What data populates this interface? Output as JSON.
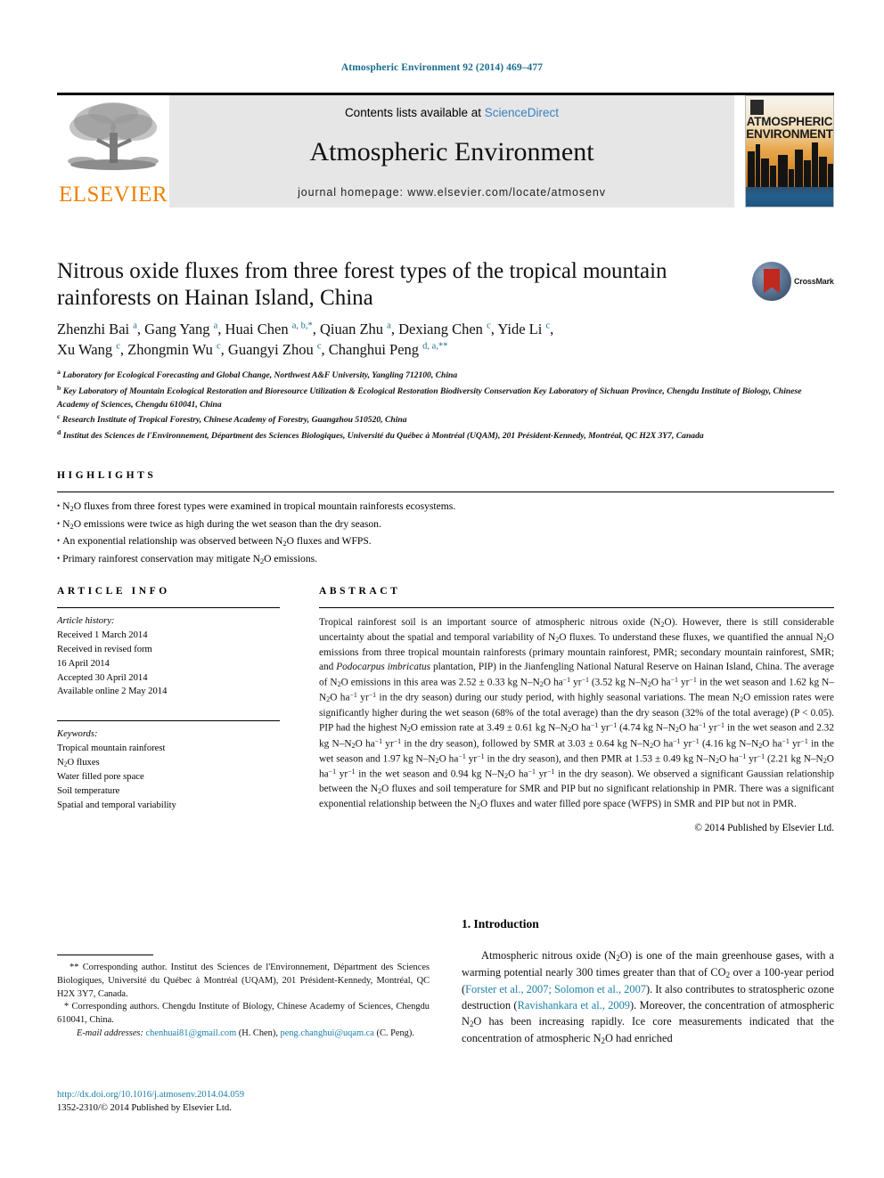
{
  "running_head": "Atmospheric Environment 92 (2014) 469–477",
  "masthead": {
    "elsevier_wordmark": "ELSEVIER",
    "contents_prefix": "Contents lists available at ",
    "sciencedirect": "ScienceDirect",
    "journal_title": "Atmospheric Environment",
    "homepage": "journal homepage: www.elsevier.com/locate/atmosenv",
    "cover_title_line1": "ATMOSPHERIC",
    "cover_title_line2": "ENVIRONMENT"
  },
  "article": {
    "title": "Nitrous oxide fluxes from three forest types of the tropical mountain rainforests on Hainan Island, China",
    "crossmark_label": "CrossMark",
    "authors_line1": "Zhenzhi Bai <sup>a</sup>, Gang Yang <sup>a</sup>, Huai Chen <sup>a, b,</sup><sup>*</sup>, Qiuan Zhu <sup>a</sup>, Dexiang Chen <sup>c</sup>, Yide Li <sup>c</sup>,",
    "authors_line2": "Xu Wang <sup>c</sup>, Zhongmin Wu <sup>c</sup>, Guangyi Zhou <sup>c</sup>, Changhui Peng <sup>d, a,</sup><sup>**</sup>",
    "affiliations": [
      "<sup>a</sup> Laboratory for Ecological Forecasting and Global Change, Northwest A&F University, Yangling 712100, China",
      "<sup>b</sup> Key Laboratory of Mountain Ecological Restoration and Bioresource Utilization &amp; Ecological Restoration Biodiversity Conservation Key Laboratory of Sichuan Province, Chengdu Institute of Biology, Chinese Academy of Sciences, Chengdu 610041, China",
      "<sup>c</sup> Research Institute of Tropical Forestry, Chinese Academy of Forestry, Guangzhou 510520, China",
      "<sup>d</sup> Institut des Sciences de l'Environnement, Départment des Sciences Biologiques, Université du Québec à Montréal (UQAM), 201 Président-Kennedy, Montréal, QC H2X 3Y7, Canada"
    ]
  },
  "highlights": {
    "label": "HIGHLIGHTS",
    "items": [
      "N<sub>2</sub>O fluxes from three forest types were examined in tropical mountain rainforests ecosystems.",
      "N<sub>2</sub>O emissions were twice as high during the wet season than the dry season.",
      "An exponential relationship was observed between N<sub>2</sub>O fluxes and WFPS.",
      "Primary rainforest conservation may mitigate N<sub>2</sub>O emissions."
    ]
  },
  "article_info": {
    "label": "ARTICLE INFO",
    "history_label": "Article history:",
    "history": [
      "Received 1 March 2014",
      "Received in revised form",
      "16 April 2014",
      "Accepted 30 April 2014",
      "Available online 2 May 2014"
    ],
    "keywords_label": "Keywords:",
    "keywords": [
      "Tropical mountain rainforest",
      "N<sub>2</sub>O fluxes",
      "Water filled pore space",
      "Soil temperature",
      "Spatial and temporal variability"
    ]
  },
  "abstract": {
    "label": "ABSTRACT",
    "text": "Tropical rainforest soil is an important source of atmospheric nitrous oxide (N<sub>2</sub>O). However, there is still considerable uncertainty about the spatial and temporal variability of N<sub>2</sub>O fluxes. To understand these fluxes, we quantified the annual N<sub>2</sub>O emissions from three tropical mountain rainforests (primary mountain rainforest, PMR; secondary mountain rainforest, SMR; and <span class=\"it\">Podocarpus imbricatus</span> plantation, PIP) in the Jianfengling National Natural Reserve on Hainan Island, China. The average of N<sub>2</sub>O emissions in this area was 2.52 ± 0.33 kg N–N<sub>2</sub>O ha<sup class=\"num\">−1</sup> yr<sup class=\"num\">−1</sup> (3.52 kg N–N<sub>2</sub>O ha<sup class=\"num\">−1</sup> yr<sup class=\"num\">−1</sup> in the wet season and 1.62 kg N–N<sub>2</sub>O ha<sup class=\"num\">−1</sup> yr<sup class=\"num\">−1</sup> in the dry season) during our study period, with highly seasonal variations. The mean N<sub>2</sub>O emission rates were significantly higher during the wet season (68% of the total average) than the dry season (32% of the total average) (P &lt; 0.05). PIP had the highest N<sub>2</sub>O emission rate at 3.49 ± 0.61 kg N–N<sub>2</sub>O ha<sup class=\"num\">−1</sup> yr<sup class=\"num\">−1</sup> (4.74 kg N–N<sub>2</sub>O ha<sup class=\"num\">−1</sup> yr<sup class=\"num\">−1</sup> in the wet season and 2.32 kg N–N<sub>2</sub>O ha<sup class=\"num\">−1</sup> yr<sup class=\"num\">−1</sup> in the dry season), followed by SMR at 3.03 ± 0.64 kg N–N<sub>2</sub>O ha<sup class=\"num\">−1</sup> yr<sup class=\"num\">−1</sup> (4.16 kg N–N<sub>2</sub>O ha<sup class=\"num\">−1</sup> yr<sup class=\"num\">−1</sup> in the wet season and 1.97 kg N–N<sub>2</sub>O ha<sup class=\"num\">−1</sup> yr<sup class=\"num\">−1</sup> in the dry season), and then PMR at 1.53 ± 0.49 kg N–N<sub>2</sub>O ha<sup class=\"num\">−1</sup> yr<sup class=\"num\">−1</sup> (2.21 kg N–N<sub>2</sub>O ha<sup class=\"num\">−1</sup> yr<sup class=\"num\">−1</sup> in the wet season and 0.94 kg N–N<sub>2</sub>O ha<sup class=\"num\">−1</sup> yr<sup class=\"num\">−1</sup> in the dry season). We observed a significant Gaussian relationship between the N<sub>2</sub>O fluxes and soil temperature for SMR and PIP but no significant relationship in PMR. There was a significant exponential relationship between the N<sub>2</sub>O fluxes and water filled pore space (WFPS) in SMR and PIP but not in PMR.",
    "copyright": "© 2014 Published by Elsevier Ltd."
  },
  "footnotes": {
    "corresponding": "<span style=\"padding-left:14px\"></span>** Corresponding author. Institut des Sciences de l'Environnement, Départment des Sciences Biologiques, Université du Québec à Montréal (UQAM), 201 Président-Kennedy, Montréal, QC H2X 3Y7, Canada.<br><span style=\"padding-left:8px\"></span>* Corresponding authors. Chengdu Institute of Biology, Chinese Academy of Sciences, Chengdu 610041, China.<br><span style=\"padding-left:22px\"></span><span class=\"it\">E-mail addresses:</span> <span class=\"lnk\">chenhuai81@gmail.com</span> (H. Chen), <span class=\"lnk\">peng.changhui@uqam.ca</span> (C. Peng).",
    "doi": "http://dx.doi.org/10.1016/j.atmosenv.2014.04.059",
    "issn_line": "1352-2310/© 2014 Published by Elsevier Ltd."
  },
  "introduction": {
    "heading": "1. Introduction",
    "paragraph": "Atmospheric nitrous oxide (N<sub>2</sub>O) is one of the main greenhouse gases, with a warming potential nearly 300 times greater than that of CO<sub>2</sub> over a 100-year period (<span class=\"cite\">Forster et al., 2007; Solomon et al., 2007</span>). It also contributes to stratospheric ozone destruction (<span class=\"cite\">Ravishankara et al., 2009</span>). Moreover, the concentration of atmospheric N<sub>2</sub>O has been increasing rapidly. Ice core measurements indicated that the concentration of atmospheric N<sub>2</sub>O had enriched"
  }
}
